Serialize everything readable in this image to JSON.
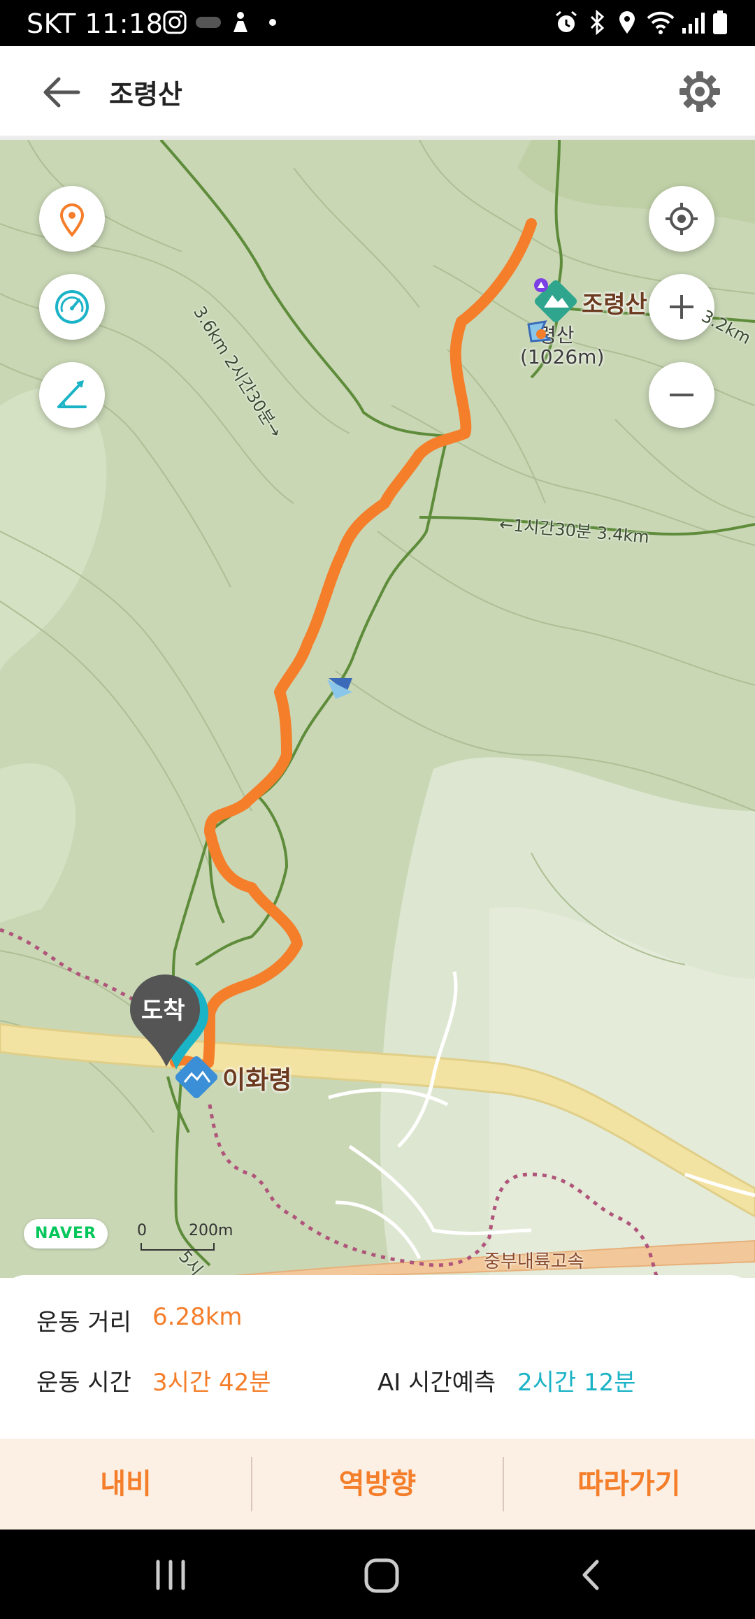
{
  "status_bar": {
    "time": "SKT 11:18",
    "icons": [
      "instagram-icon",
      "game-icon",
      "notification-icon",
      "dot-icon",
      "alarm-icon",
      "bluetooth-icon",
      "location-icon",
      "wifi-icon",
      "signal-icon",
      "battery-icon"
    ]
  },
  "app_bar": {
    "title": "조령산",
    "back_icon": "arrow-left-icon",
    "settings_icon": "gear-icon"
  },
  "map": {
    "left_controls": [
      "location-pin-icon",
      "speedometer-icon",
      "slope-icon"
    ],
    "right_controls": [
      "my-location-icon",
      "zoom-in-icon",
      "zoom-out-icon"
    ],
    "peak_name": "조령산",
    "peak_sub_1": "령산",
    "peak_sub_2": "(1026m)",
    "trail_label_1": "3.6km 2시간30분→",
    "trail_label_2": "←1시간30분 3.4km",
    "trail_label_3": "3.2km",
    "end_marker": "도착",
    "pass_name": "이화령",
    "road_name": "중부내륙고속",
    "trail_label_4": "5시",
    "brand": "NAVER",
    "scale_start": "0",
    "scale_end": "200m",
    "colors": {
      "route": "#f47e2a",
      "trail": "#5e8c3a",
      "road": "#f3e3a2",
      "terrain": "#c9d7b5"
    }
  },
  "stats": {
    "distance_label": "운동 거리",
    "distance_value": "6.28km",
    "time_label": "운동 시간",
    "time_value": "3시간 42분",
    "ai_label": "AI 시간예측",
    "ai_value": "2시간 12분"
  },
  "actions": {
    "nav_label": "내비",
    "reverse_label": "역방향",
    "follow_label": "따라가기"
  },
  "nav_bar": {
    "icons": [
      "recent-apps-icon",
      "home-icon",
      "back-icon"
    ]
  }
}
